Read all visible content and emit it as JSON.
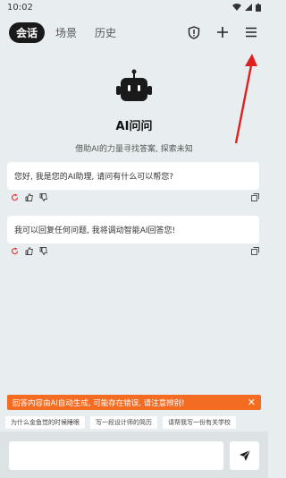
{
  "status": {
    "time": "10:02"
  },
  "tabs": [
    {
      "label": "会话"
    },
    {
      "label": "场景"
    },
    {
      "label": "历史"
    }
  ],
  "hero": {
    "title": "AI问问",
    "subtitle": "借助AI的力量寻找答案, 探索未知"
  },
  "messages": [
    {
      "text": "您好, 我是您的AI助理, 请问有什么可以帮您?"
    },
    {
      "text": "我可以回复任何问题, 我将调动智能AI回答您!"
    }
  ],
  "banner": {
    "text": "回答内容由AI自动生成, 可能存在错误, 请注意辨别!"
  },
  "suggestions": [
    {
      "text": "为什么金鱼觉的时候睡眼"
    },
    {
      "text": "写一段设计师的简历"
    },
    {
      "text": "请帮我写一份有关学校"
    }
  ],
  "colors": {
    "accent": "#f36c21",
    "arrow": "#e02020",
    "tab_active_bg": "#1a1a1a"
  }
}
